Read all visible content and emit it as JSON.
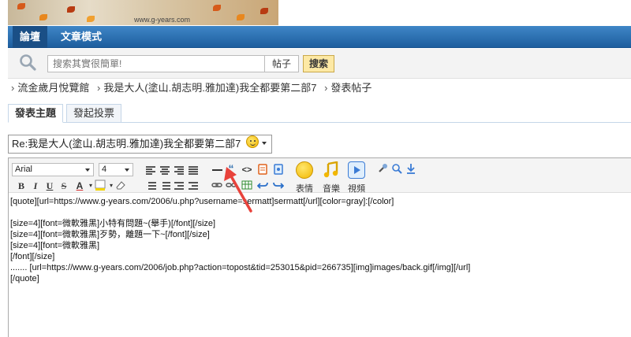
{
  "banner": {
    "url_text": "www.g-years.com"
  },
  "nav": {
    "tabs": [
      {
        "label": "論壇",
        "active": true
      },
      {
        "label": "文章模式",
        "active": false
      }
    ]
  },
  "search": {
    "placeholder": "搜索其實很簡單!",
    "type_label": "帖子",
    "button_label": "搜索"
  },
  "breadcrumb": {
    "items": [
      "流金歲月悅覽館",
      "我是大人(塗山.胡志明.雅加達)我全都要第二部7",
      "發表帖子"
    ]
  },
  "post_tabs": [
    {
      "label": "發表主題",
      "active": true
    },
    {
      "label": "發起投票",
      "active": false
    }
  ],
  "subject": {
    "value": "Re:我是大人(塗山.胡志明.雅加達)我全都要第二部7"
  },
  "toolbar": {
    "font_family": "Arial",
    "font_size": "4",
    "bold_label": "B",
    "italic_label": "I",
    "underline_label": "U",
    "strike_label": "S",
    "color_label": "A",
    "emoticon_label": "表情",
    "music_label": "音樂",
    "video_label": "視頻"
  },
  "editor_content": {
    "lines": [
      "[quote][url=https://www.g-years.com/2006/u.php?username=sermatt]sermatt[/url][color=gray]:[/color]",
      "",
      "[size=4][font=微軟雅黑]小特有問題~(舉手)[/font][/size]",
      "[size=4][font=微軟雅黑]歹勢，離題一下~[/font][/size]",
      "[size=4][font=微軟雅黑]",
      "[/font][/size]",
      "....... [url=https://www.g-years.com/2006/job.php?action=topost&tid=253015&pid=266735][img]images/back.gif[/img][/url]",
      "[/quote]"
    ]
  },
  "colors": {
    "nav_bar": "#2a6fb0",
    "search_button": "#fde9a5",
    "arrow": "#e8423b"
  }
}
